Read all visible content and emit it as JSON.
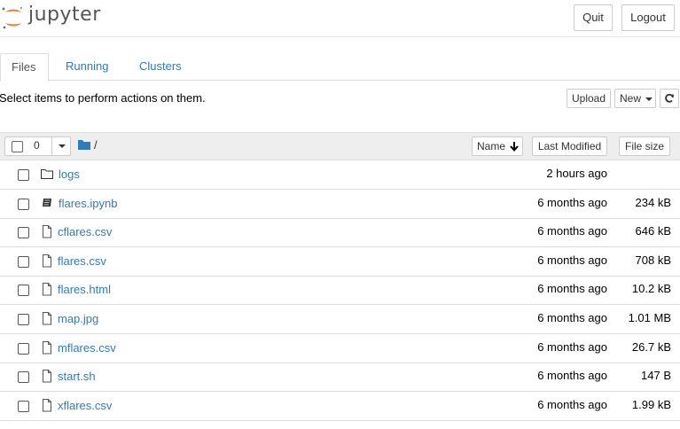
{
  "header": {
    "logo_text": "jupyter",
    "quit_label": "Quit",
    "logout_label": "Logout"
  },
  "tabs": [
    {
      "label": "Files"
    },
    {
      "label": "Running"
    },
    {
      "label": "Clusters"
    }
  ],
  "toolbar": {
    "select_message": "Select items to perform actions on them.",
    "upload_label": "Upload",
    "new_label": "New",
    "refresh_icon": "refresh-icon"
  },
  "list_header": {
    "selected_count": "0",
    "path": "/",
    "name_label": "Name",
    "sort_icon": "arrow-down-icon",
    "modified_label": "Last Modified",
    "size_label": "File size"
  },
  "files": [
    {
      "name": "logs",
      "type": "folder",
      "modified": "2 hours ago",
      "size": ""
    },
    {
      "name": "flares.ipynb",
      "type": "notebook",
      "modified": "6 months ago",
      "size": "234 kB"
    },
    {
      "name": "cflares.csv",
      "type": "file",
      "modified": "6 months ago",
      "size": "646 kB"
    },
    {
      "name": "flares.csv",
      "type": "file",
      "modified": "6 months ago",
      "size": "708 kB"
    },
    {
      "name": "flares.html",
      "type": "file",
      "modified": "6 months ago",
      "size": "10.2 kB"
    },
    {
      "name": "map.jpg",
      "type": "file",
      "modified": "6 months ago",
      "size": "1.01 MB"
    },
    {
      "name": "mflares.csv",
      "type": "file",
      "modified": "6 months ago",
      "size": "26.7 kB"
    },
    {
      "name": "start.sh",
      "type": "file",
      "modified": "6 months ago",
      "size": "147 B"
    },
    {
      "name": "xflares.csv",
      "type": "file",
      "modified": "6 months ago",
      "size": "1.99 kB"
    }
  ],
  "colors": {
    "link": "#337ab7",
    "logo_orange": "#f37726",
    "header_bg": "#eeeeee"
  }
}
